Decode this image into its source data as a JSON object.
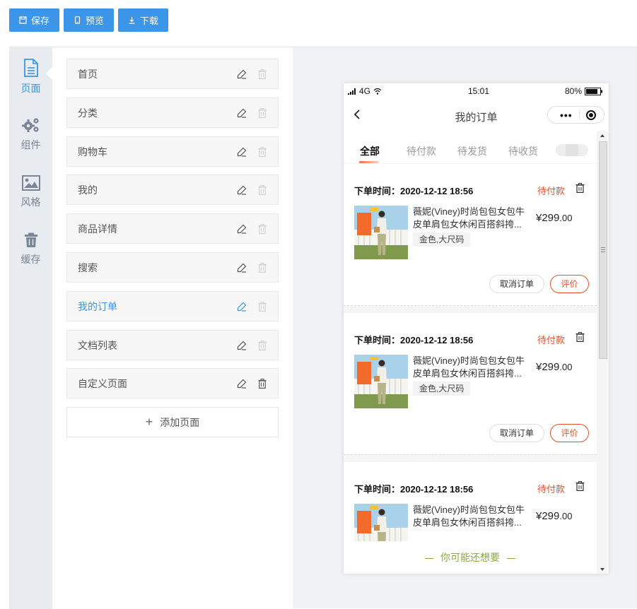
{
  "toolbar": {
    "save_label": "保存",
    "preview_label": "预览",
    "download_label": "下载",
    "accent_color": "#3b95e8"
  },
  "rail": {
    "items": [
      {
        "label": "页面",
        "icon": "document-icon",
        "active": true
      },
      {
        "label": "组件",
        "icon": "gears-icon",
        "active": false
      },
      {
        "label": "风格",
        "icon": "image-icon",
        "active": false
      },
      {
        "label": "缓存",
        "icon": "trash-icon",
        "active": false
      }
    ]
  },
  "pages": {
    "items": [
      {
        "label": "首页"
      },
      {
        "label": "分类"
      },
      {
        "label": "购物车"
      },
      {
        "label": "我的"
      },
      {
        "label": "商品详情"
      },
      {
        "label": "搜索"
      },
      {
        "label": "我的订单",
        "active": true
      },
      {
        "label": "文档列表"
      },
      {
        "label": "自定义页面"
      }
    ],
    "add_label": "添加页面",
    "add_icon": "+"
  },
  "phone": {
    "status": {
      "signal": "4G",
      "time": "15:01",
      "battery": "80%"
    },
    "title": "我的订单",
    "tabs": [
      "全部",
      "待付款",
      "待发货",
      "待收货"
    ],
    "active_tab": "全部",
    "orders": [
      {
        "time_label": "下单时间：2020-12-12 18:56",
        "status": "待付款",
        "product_name": "薇妮(Viney)时尚包包女包牛皮单肩包女休闲百搭斜挎...",
        "sku": "金色,大尺码",
        "price_symbol": "¥",
        "price_int": "299",
        "price_dec": ".00",
        "cancel_label": "取消订单",
        "review_label": "评价"
      },
      {
        "time_label": "下单时间：2020-12-12 18:56",
        "status": "待付款",
        "product_name": "薇妮(Viney)时尚包包女包牛皮单肩包女休闲百搭斜挎...",
        "sku": "金色,大尺码",
        "price_symbol": "¥",
        "price_int": "299",
        "price_dec": ".00",
        "cancel_label": "取消订单",
        "review_label": "评价"
      },
      {
        "time_label": "下单时间：2020-12-12 18:56",
        "status": "待付款",
        "product_name": "薇妮(Viney)时尚包包女包牛皮单肩包女休闲百搭斜挎...",
        "sku": "",
        "price_symbol": "¥",
        "price_int": "299",
        "price_dec": ".00",
        "cancel_label": "",
        "review_label": ""
      }
    ],
    "maybe_like": "你可能还想要",
    "status_color": "#e5512c",
    "maybe_color": "#8aab3c"
  }
}
